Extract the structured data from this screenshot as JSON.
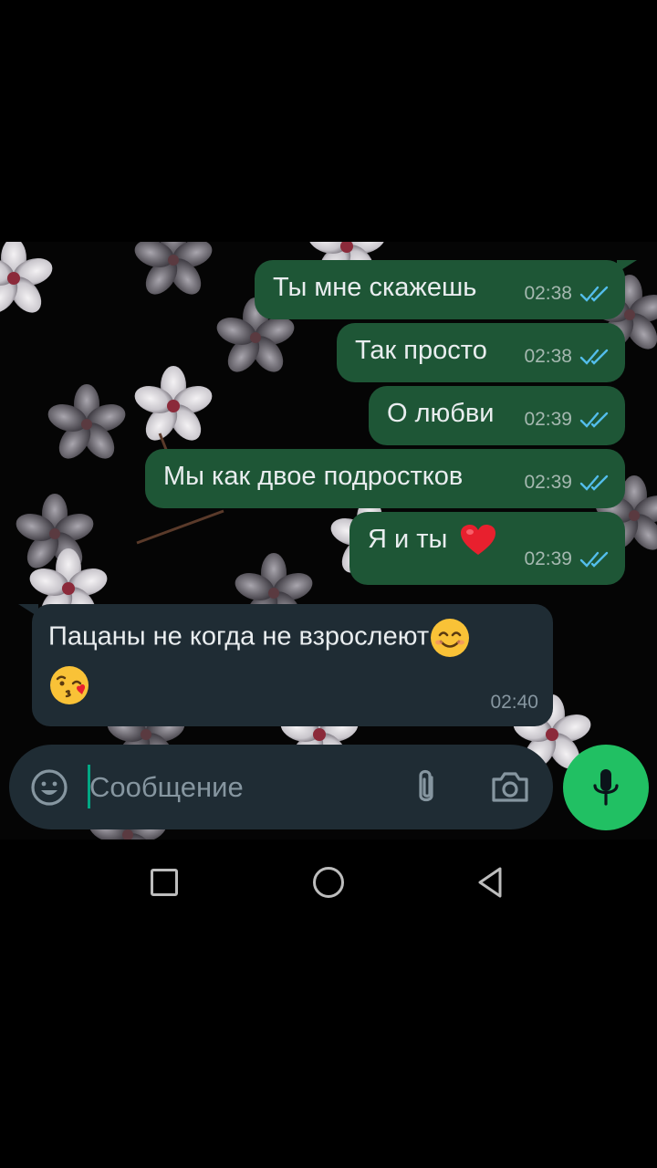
{
  "messages": [
    {
      "direction": "out",
      "text": "Ты мне скажешь",
      "time": "02:38",
      "status": "read"
    },
    {
      "direction": "out",
      "text": "Так просто",
      "time": "02:38",
      "status": "read"
    },
    {
      "direction": "out",
      "text": "О любви",
      "time": "02:39",
      "status": "read"
    },
    {
      "direction": "out",
      "text": "Мы как двое подростков",
      "time": "02:39",
      "status": "read"
    },
    {
      "direction": "out",
      "text": "Я и ты",
      "emoji": "red-heart",
      "time": "02:39",
      "status": "read"
    },
    {
      "direction": "in",
      "text": "Пацаны не когда не взрослеют",
      "emoji": [
        "smiling-face",
        "kissing-face-with-heart"
      ],
      "time": "02:40"
    }
  ],
  "composer": {
    "placeholder": "Сообщение",
    "icons": [
      "emoji-icon",
      "paperclip-icon",
      "camera-icon",
      "microphone-icon"
    ]
  },
  "navigation": {
    "icons": [
      "recents-square-icon",
      "home-circle-icon",
      "back-triangle-icon"
    ]
  },
  "colors": {
    "outgoing_bubble": "#1e5636",
    "incoming_bubble": "#1f2c34",
    "accent": "#21c063",
    "read_ticks": "#53bdeb",
    "background": "#000000"
  }
}
